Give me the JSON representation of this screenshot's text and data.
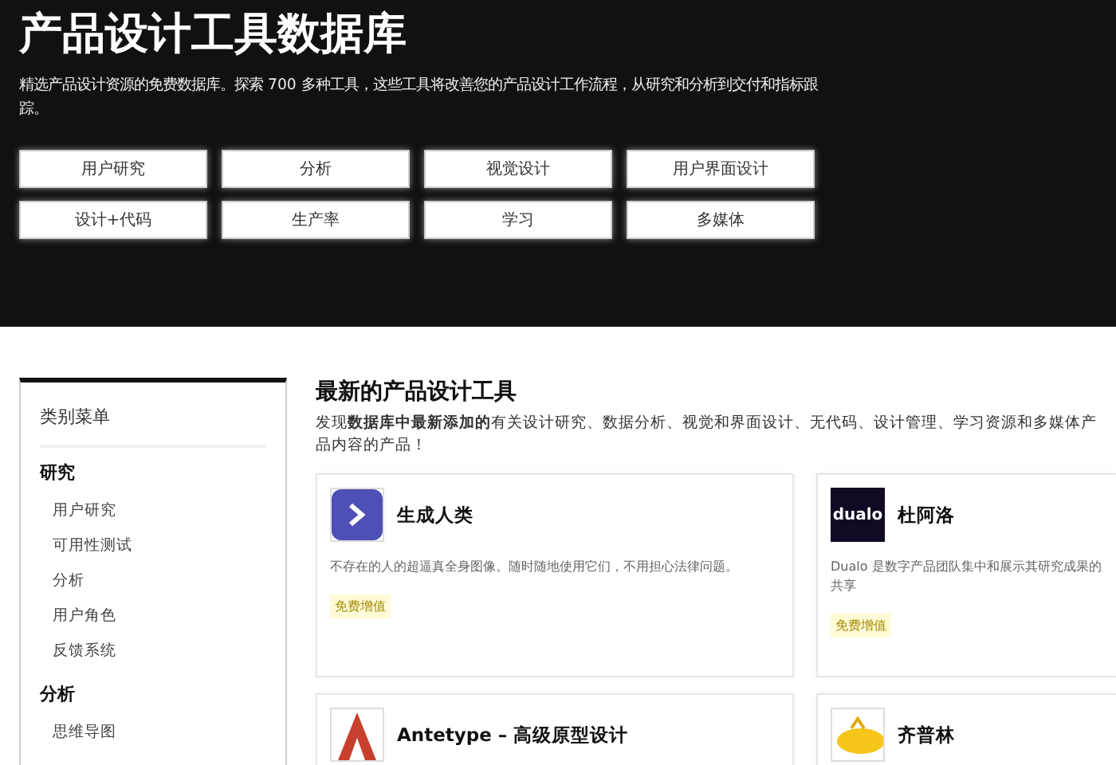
{
  "hero": {
    "title": "产品设计工具数据库",
    "description": "精选产品设计资源的免费数据库。探索 700 多种工具，这些工具将改善您的产品设计工作流程，从研究和分析到交付和指标跟踪。",
    "categories": [
      "用户研究",
      "分析",
      "视觉设计",
      "用户界面设计",
      "设计+代码",
      "生产率",
      "学习",
      "多媒体"
    ]
  },
  "sidebar": {
    "title": "类别菜单",
    "groups": [
      {
        "label": "研究",
        "items": [
          "用户研究",
          "可用性测试",
          "分析",
          "用户角色",
          "反馈系统"
        ]
      },
      {
        "label": "分析",
        "items": [
          "思维导图"
        ]
      }
    ]
  },
  "main": {
    "title": "最新的产品设计工具",
    "intro": "发现**数据库中最新添加的**有关设计研究、数据分析、视觉和界面设计、无代码、设计管理、学习资源和多媒体产品内容的产品！",
    "tools": [
      {
        "kind": "chevron",
        "name": "生成人类",
        "description": "不存在的人的超逼真全身图像。随时随地使用它们，不用担心法律问题。",
        "tag": "免费增值"
      },
      {
        "kind": "wordmark",
        "logo_text": "dualo",
        "name": "杜阿洛",
        "description": "Dualo 是数字产品团队集中和展示其研究成果的共享",
        "tag": "免费增值"
      },
      {
        "kind": "letter-a",
        "name": "Antetype – 高级原型设计"
      },
      {
        "kind": "blimp",
        "name": "齐普林"
      }
    ]
  }
}
